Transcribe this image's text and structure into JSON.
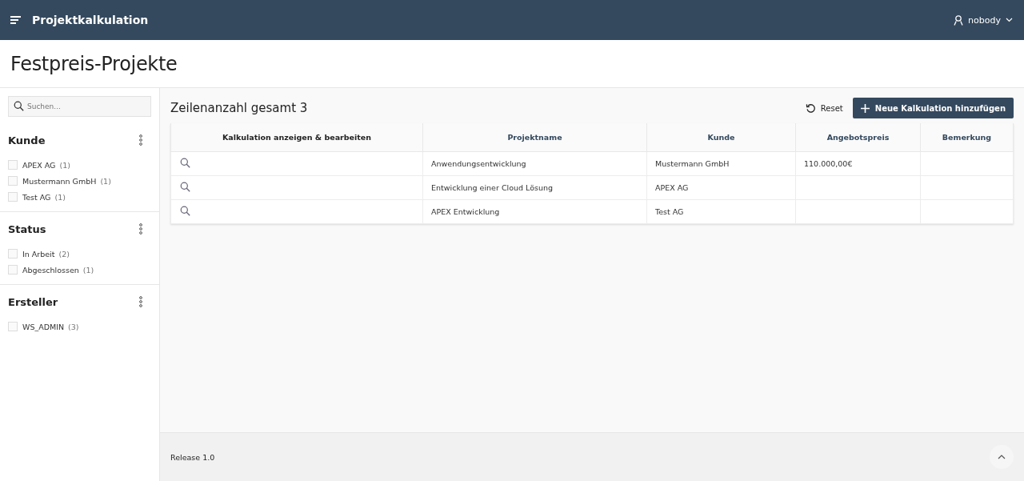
{
  "header": {
    "app_title": "Projektkalkulation",
    "user": "nobody"
  },
  "page_title": "Festpreis-Projekte",
  "sidebar": {
    "search": {
      "placeholder": "Suchen..."
    },
    "facets": [
      {
        "title": "Kunde",
        "options": [
          {
            "label": "APEX AG",
            "count": "(1)",
            "checked": false
          },
          {
            "label": "Mustermann GmbH",
            "count": "(1)",
            "checked": false
          },
          {
            "label": "Test AG",
            "count": "(1)",
            "checked": false
          }
        ]
      },
      {
        "title": "Status",
        "options": [
          {
            "label": "In Arbeit",
            "count": "(2)",
            "checked": false
          },
          {
            "label": "Abgeschlossen",
            "count": "(1)",
            "checked": false
          }
        ]
      },
      {
        "title": "Ersteller",
        "options": [
          {
            "label": "WS_ADMIN",
            "count": "(3)",
            "checked": false
          }
        ]
      }
    ]
  },
  "report": {
    "title": "Zeilenanzahl gesamt 3",
    "reset_label": "Reset",
    "add_button": "Neue Kalkulation hinzufügen",
    "columns": [
      "Kalkulation anzeigen & bearbeiten",
      "Projektname",
      "Kunde",
      "Angebotspreis",
      "Bemerkung"
    ],
    "rows": [
      {
        "projektname": "Anwendungsentwicklung",
        "kunde": "Mustermann GmbH",
        "angebotspreis": "110.000,00€"
      },
      {
        "projektname": "Entwicklung einer Cloud Lösung",
        "kunde": "APEX AG"
      },
      {
        "projektname": "APEX Entwicklung",
        "kunde": "Test AG"
      }
    ]
  },
  "footer": {
    "release": "Release 1.0"
  }
}
